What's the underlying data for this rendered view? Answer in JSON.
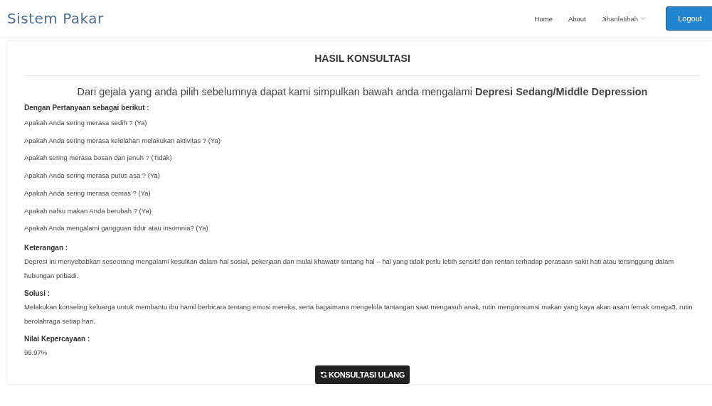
{
  "navbar": {
    "brand": "Sistem Pakar",
    "links": [
      {
        "label": "Home",
        "kind": "link"
      },
      {
        "label": "About",
        "kind": "link"
      },
      {
        "label": "Jihanfatihah",
        "kind": "dropdown"
      }
    ],
    "logout": "Logout"
  },
  "result": {
    "title": "HASIL KONSULTASI",
    "conclusion": "Dari gejala yang anda pilih sebelumnya dapat kami simpulkan bawah anda mengalami **Depresi Sedang/Middle Depression**",
    "questions_heading": "Dengan Pertanyaan sebagai berikut :",
    "questions": [
      "Apakah Anda sering merasa sedih ? (Ya)",
      "Apakah Anda sering merasa kelelahan melakukan aktivitas ? (Ya)",
      "Apakah sering merasa bosan dan jenuh ? (Tidak)",
      "Apakah Anda sering merasa putus asa ? (Ya)",
      "Apakah Anda sering merasa cemas ? (Ya)",
      "Apakah nafsu makan Anda berubah ? (Ya)",
      "Apakah Anda mengalami gangguan tidur atau insomnia? (Ya)"
    ],
    "sections": [
      {
        "heading": "Keterangan :",
        "text": "Depresi ini menyebabkan seseorang mengalami kesulitan dalam hal sosial, pekerjaan dan mulai khawatir tentang hal – hal yang tidak perlu lebih sensitif dan rentan terhadap perasaan sakit hati atau tersinggung dalam hubungan pribadi."
      },
      {
        "heading": "Solusi :",
        "text": "Melakukan konseling keluarga untuk membantu ibu hamil berbicara tentang emosi mereka, serta bagaimana mengelola tantangan saat mengasuh anak, rutin mengonsumsi makan yang kaya akan asam lemak omega3, rutin berolahraga setiap hari."
      },
      {
        "heading": "Nilai Kepercayaan :",
        "text": "99.97%"
      }
    ],
    "retry_button": "KONSULTASI ULANG"
  }
}
